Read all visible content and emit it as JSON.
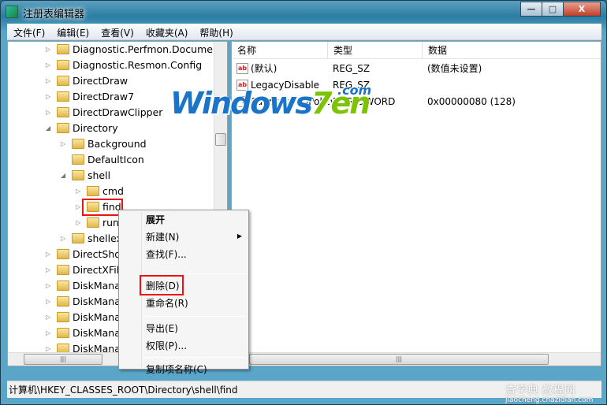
{
  "window": {
    "title": "注册表编辑器",
    "minimize": "—",
    "maximize": "□",
    "close": "X"
  },
  "menubar": [
    "文件(F)",
    "编辑(E)",
    "查看(V)",
    "收藏夹(A)",
    "帮助(H)"
  ],
  "tree": [
    {
      "label": "Diagnostic.Perfmon.Document",
      "level": 0,
      "state": "collapsed"
    },
    {
      "label": "Diagnostic.Resmon.Config",
      "level": 0,
      "state": "collapsed"
    },
    {
      "label": "DirectDraw",
      "level": 0,
      "state": "collapsed"
    },
    {
      "label": "DirectDraw7",
      "level": 0,
      "state": "collapsed"
    },
    {
      "label": "DirectDrawClipper",
      "level": 0,
      "state": "collapsed"
    },
    {
      "label": "Directory",
      "level": 0,
      "state": "expanded"
    },
    {
      "label": "Background",
      "level": 1,
      "state": "collapsed"
    },
    {
      "label": "DefaultIcon",
      "level": 1,
      "state": "leaf"
    },
    {
      "label": "shell",
      "level": 1,
      "state": "expanded"
    },
    {
      "label": "cmd",
      "level": 2,
      "state": "collapsed"
    },
    {
      "label": "find",
      "level": 2,
      "state": "collapsed",
      "selected": true
    },
    {
      "label": "run",
      "level": 2,
      "state": "collapsed"
    },
    {
      "label": "shellex",
      "level": 1,
      "state": "collapsed"
    },
    {
      "label": "DirectShow",
      "level": 0,
      "state": "collapsed"
    },
    {
      "label": "DirectXFile",
      "level": 0,
      "state": "collapsed"
    },
    {
      "label": "DiskMana",
      "level": 0,
      "state": "collapsed"
    },
    {
      "label": "DiskMana",
      "level": 0,
      "state": "collapsed"
    },
    {
      "label": "DiskMana",
      "level": 0,
      "state": "collapsed"
    },
    {
      "label": "DiskMana",
      "level": 0,
      "state": "collapsed"
    },
    {
      "label": "DiskMana",
      "level": 0,
      "state": "collapsed"
    },
    {
      "label": "DiskMana",
      "level": 0,
      "state": "collapsed"
    }
  ],
  "list": {
    "columns": [
      "名称",
      "类型",
      "数据"
    ],
    "rows": [
      {
        "icon": "string-value-icon",
        "name": "(默认)",
        "type": "REG_SZ",
        "data": "(数值未设置)"
      },
      {
        "icon": "string-value-icon",
        "name": "LegacyDisable",
        "type": "REG_SZ",
        "data": ""
      },
      {
        "icon": "dword-value-icon",
        "name": "SuppressionPolicy",
        "type": "REG_DWORD",
        "data": "0x00000080 (128)"
      }
    ]
  },
  "context_menu": [
    {
      "label": "展开",
      "bold": true
    },
    {
      "label": "新建(N)",
      "submenu": true
    },
    {
      "label": "查找(F)..."
    },
    {
      "sep": true
    },
    {
      "label": "删除(D)",
      "highlight": true
    },
    {
      "label": "重命名(R)"
    },
    {
      "sep": true
    },
    {
      "label": "导出(E)"
    },
    {
      "label": "权限(P)..."
    },
    {
      "sep": true
    },
    {
      "label": "复制项名称(C)"
    }
  ],
  "status": "计算机\\HKEY_CLASSES_ROOT\\Directory\\shell\\find",
  "watermarks": {
    "logo_main": "Windows",
    "logo_seven": "7en",
    "logo_com": ".com",
    "site_cn": "查字典 教程网",
    "site_url": "jiaocheng.chazidian.com"
  },
  "colors": {
    "highlight_box": "#ee1111",
    "title_bar": "#2b7da3"
  }
}
